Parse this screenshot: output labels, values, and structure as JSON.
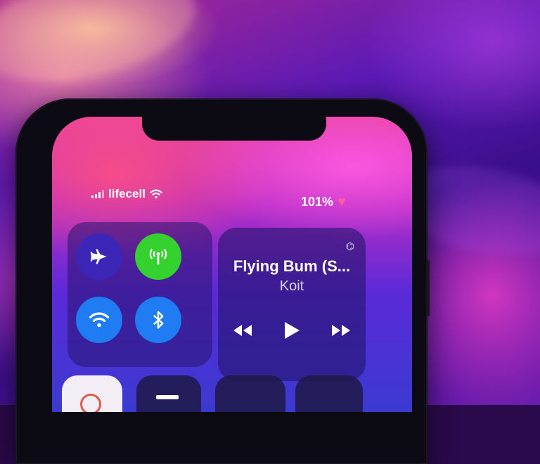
{
  "status_bar": {
    "carrier": "lifecell",
    "battery": "101%"
  },
  "connectivity": {
    "buttons": [
      "airplane-mode",
      "cellular-data",
      "wifi",
      "bluetooth"
    ],
    "active_color_cellular": "#34d12f",
    "active_color_blue": "#1f7cf2"
  },
  "media": {
    "song_title": "Flying Bum (S...",
    "artist": "Koit"
  }
}
